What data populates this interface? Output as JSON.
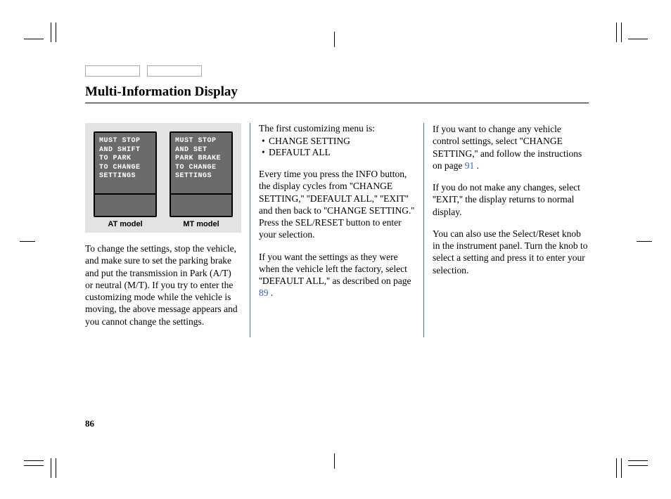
{
  "title": "Multi-Information Display",
  "page_number": "86",
  "figure": {
    "screens": [
      {
        "text": "MUST STOP\nAND SHIFT\nTO PARK\nTO CHANGE\nSETTINGS",
        "caption": "AT model"
      },
      {
        "text": "MUST STOP\nAND SET\nPARK BRAKE\nTO CHANGE\nSETTINGS",
        "caption": "MT model"
      }
    ]
  },
  "col1": {
    "p1": "To change the settings, stop the vehicle, and make sure to set the parking brake and put the transmission in Park (A/T) or neutral (M/T). If you try to enter the customizing mode while the vehicle is moving, the above message appears and you cannot change the settings."
  },
  "col2": {
    "intro": "The first customizing menu is:",
    "bullets": [
      "CHANGE SETTING",
      "DEFAULT ALL"
    ],
    "p1": "Every time you press the INFO button, the display cycles from ''CHANGE SETTING,'' ''DEFAULT ALL,'' ''EXIT'' and then back to ''CHANGE SETTING.'' Press the SEL/RESET button to enter your selection.",
    "p2a": "If you want the settings as they were when the vehicle left the factory, select ''DEFAULT ALL,'' as described on page ",
    "p2link": "89",
    "p2b": " ."
  },
  "col3": {
    "p1a": "If you want to change any vehicle control settings, select ''CHANGE SETTING,'' and follow the instructions on page  ",
    "p1link": "91",
    "p1b": "  .",
    "p2": "If you do not make any changes, select ''EXIT,'' the display returns to normal display.",
    "p3": "You can also use the Select/Reset knob in the instrument panel. Turn the knob to select a setting and press it to enter your selection."
  }
}
